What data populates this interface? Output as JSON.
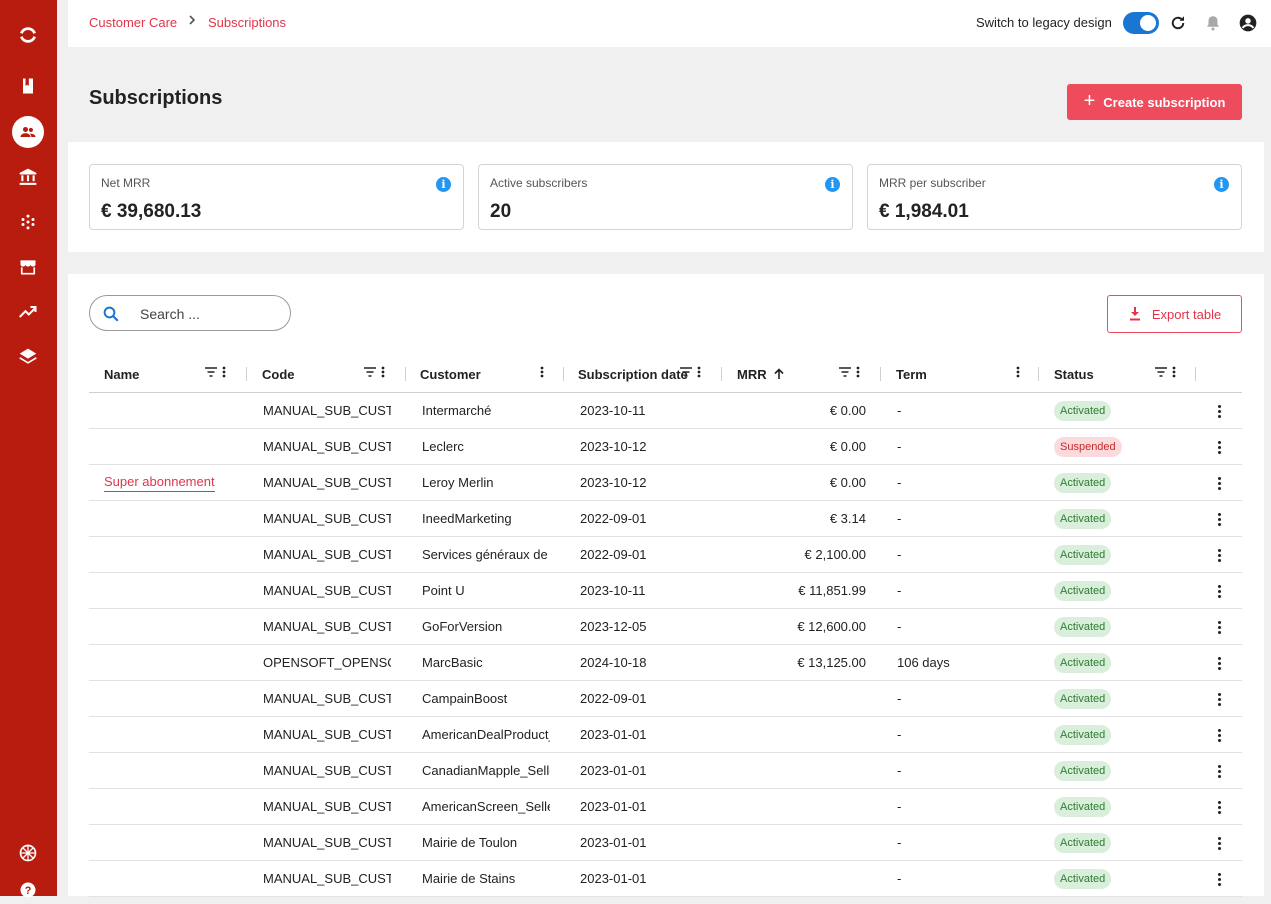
{
  "breadcrumb": {
    "items": [
      "Customer Care",
      "Subscriptions"
    ]
  },
  "header": {
    "legacy_label": "Switch to legacy design",
    "legacy_toggle_on": true
  },
  "page": {
    "title": "Subscriptions",
    "create_label": "Create subscription"
  },
  "kpis": [
    {
      "label": "Net MRR",
      "value": "€ 39,680.13"
    },
    {
      "label": "Active subscribers",
      "value": "20"
    },
    {
      "label": "MRR per subscriber",
      "value": "€ 1,984.01"
    }
  ],
  "search": {
    "placeholder": "Search ...",
    "value": ""
  },
  "export_label": "Export table",
  "table": {
    "columns": [
      "Name",
      "Code",
      "Customer",
      "Subscription date",
      "MRR",
      "Term",
      "Status"
    ],
    "sort": {
      "column": "MRR",
      "direction": "ascending"
    },
    "rows": [
      {
        "name": "",
        "code": "MANUAL_SUB_CUSTO",
        "customer": "Intermarché",
        "date": "2023-10-11",
        "mrr": "€ 0.00",
        "term": "-",
        "status": "Activated"
      },
      {
        "name": "",
        "code": "MANUAL_SUB_CUSTO",
        "customer": "Leclerc",
        "date": "2023-10-12",
        "mrr": "€ 0.00",
        "term": "-",
        "status": "Suspended"
      },
      {
        "name": "Super abonnement",
        "code": "MANUAL_SUB_CUSTO",
        "customer": "Leroy Merlin",
        "date": "2023-10-12",
        "mrr": "€ 0.00",
        "term": "-",
        "status": "Activated"
      },
      {
        "name": "",
        "code": "MANUAL_SUB_CUSTO",
        "customer": "IneedMarketing",
        "date": "2022-09-01",
        "mrr": "€ 3.14",
        "term": "-",
        "status": "Activated"
      },
      {
        "name": "",
        "code": "MANUAL_SUB_CUSTO",
        "customer": "Services généraux de C",
        "date": "2022-09-01",
        "mrr": "€ 2,100.00",
        "term": "-",
        "status": "Activated"
      },
      {
        "name": "",
        "code": "MANUAL_SUB_CUSTO",
        "customer": "Point U",
        "date": "2023-10-11",
        "mrr": "€ 11,851.99",
        "term": "-",
        "status": "Activated"
      },
      {
        "name": "",
        "code": "MANUAL_SUB_CUSTO",
        "customer": "GoForVersion",
        "date": "2023-12-05",
        "mrr": "€ 12,600.00",
        "term": "-",
        "status": "Activated"
      },
      {
        "name": "",
        "code": "OPENSOFT_OPENSOF",
        "customer": "MarcBasic",
        "date": "2024-10-18",
        "mrr": "€ 13,125.00",
        "term": "106 days",
        "status": "Activated"
      },
      {
        "name": "",
        "code": "MANUAL_SUB_CUSTO",
        "customer": "CampainBoost",
        "date": "2022-09-01",
        "mrr": "",
        "term": "-",
        "status": "Activated"
      },
      {
        "name": "",
        "code": "MANUAL_SUB_CUSTO",
        "customer": "AmericanDealProduct_",
        "date": "2023-01-01",
        "mrr": "",
        "term": "-",
        "status": "Activated"
      },
      {
        "name": "",
        "code": "MANUAL_SUB_CUSTO",
        "customer": "CanadianMapple_Selle",
        "date": "2023-01-01",
        "mrr": "",
        "term": "-",
        "status": "Activated"
      },
      {
        "name": "",
        "code": "MANUAL_SUB_CUSTO",
        "customer": "AmericanScreen_Seller",
        "date": "2023-01-01",
        "mrr": "",
        "term": "-",
        "status": "Activated"
      },
      {
        "name": "",
        "code": "MANUAL_SUB_CUSTO",
        "customer": "Mairie de Toulon",
        "date": "2023-01-01",
        "mrr": "",
        "term": "-",
        "status": "Activated"
      },
      {
        "name": "",
        "code": "MANUAL_SUB_CUSTO",
        "customer": "Mairie de Stains",
        "date": "2023-01-01",
        "mrr": "",
        "term": "-",
        "status": "Activated"
      }
    ]
  },
  "sidebar": {
    "items": [
      {
        "icon": "logo-icon"
      },
      {
        "icon": "book-icon"
      },
      {
        "icon": "customers-icon",
        "active": true
      },
      {
        "icon": "bank-icon"
      },
      {
        "icon": "network-icon"
      },
      {
        "icon": "store-icon"
      },
      {
        "icon": "trending-icon"
      },
      {
        "icon": "layers-icon"
      },
      {
        "icon": "language-flag-icon"
      },
      {
        "icon": "help-icon"
      }
    ]
  },
  "colors": {
    "sidebar": "#b71c0f",
    "accent": "#ee4b5d",
    "info": "#2196f3",
    "toggle": "#1976d2"
  }
}
